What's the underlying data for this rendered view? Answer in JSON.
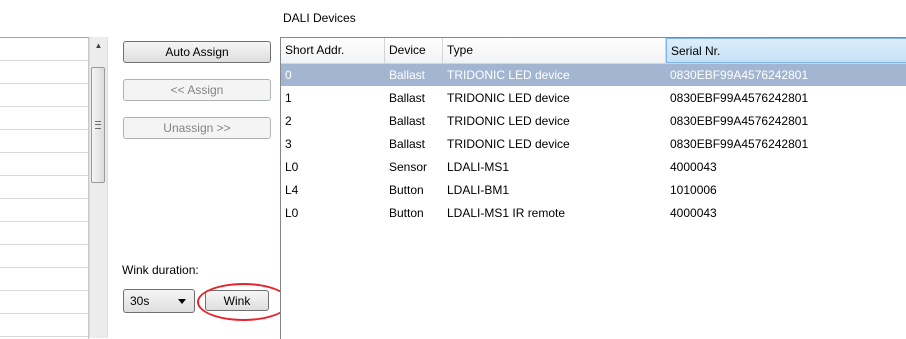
{
  "title": "DALI Devices",
  "left_panel": {
    "row_count": 13
  },
  "buttons": {
    "auto_assign": "Auto Assign",
    "assign": "<< Assign",
    "unassign": "Unassign >>",
    "wink": "Wink"
  },
  "wink": {
    "label": "Wink duration:",
    "duration": "30s"
  },
  "grid": {
    "columns": [
      "Short Addr.",
      "Device",
      "Type",
      "Serial Nr."
    ],
    "sorted_column": "Serial Nr.",
    "selected_row": 0,
    "rows": [
      [
        "0",
        "Ballast",
        "TRIDONIC LED device",
        "0830EBF99A4576242801"
      ],
      [
        "1",
        "Ballast",
        "TRIDONIC LED device",
        "0830EBF99A4576242801"
      ],
      [
        "2",
        "Ballast",
        "TRIDONIC LED device",
        "0830EBF99A4576242801"
      ],
      [
        "3",
        "Ballast",
        "TRIDONIC LED device",
        "0830EBF99A4576242801"
      ],
      [
        "L0",
        "Sensor",
        "LDALI-MS1",
        "4000043"
      ],
      [
        "L4",
        "Button",
        "LDALI-BM1",
        "1010006"
      ],
      [
        "L0",
        "Button",
        "LDALI-MS1 IR remote",
        "4000043"
      ]
    ]
  },
  "colors": {
    "selection": "#a2b6d2",
    "highlight_ring": "#e8232a"
  }
}
